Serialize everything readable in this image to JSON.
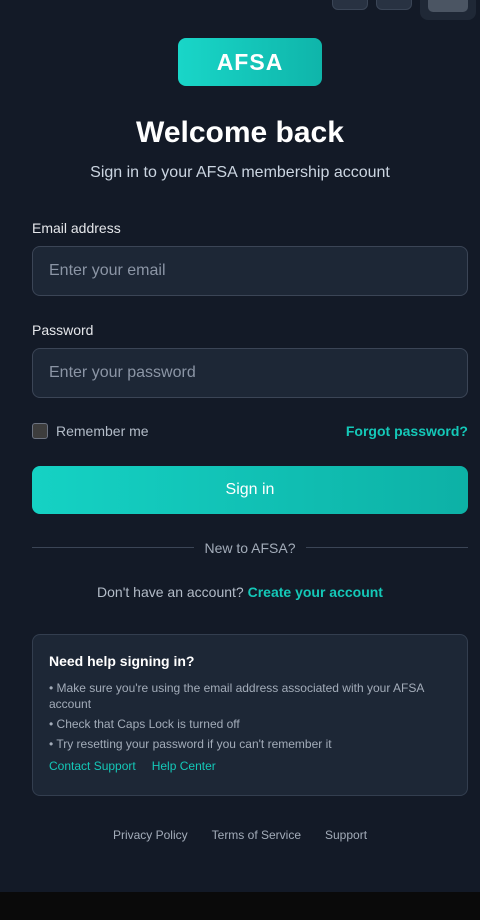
{
  "brand": {
    "logo_text": "AFSA",
    "accent": "#14c8b8"
  },
  "header": {
    "title": "Welcome back",
    "subtitle": "Sign in to your AFSA membership account"
  },
  "form": {
    "email_label": "Email address",
    "email_placeholder": "Enter your email",
    "email_value": "",
    "password_label": "Password",
    "password_placeholder": "Enter your password",
    "password_value": "",
    "remember_label": "Remember me",
    "remember_checked": false,
    "forgot_label": "Forgot password?",
    "submit_label": "Sign in"
  },
  "divider": {
    "text": "New to AFSA?"
  },
  "signup": {
    "prompt": "Don't have an account?",
    "link_label": "Create your account"
  },
  "help": {
    "title": "Need help signing in?",
    "items": [
      "• Make sure you're using the email address associated with your AFSA account",
      "• Check that Caps Lock is turned off",
      "• Try resetting your password if you can't remember it"
    ],
    "links": [
      "Contact Support",
      "Help Center"
    ]
  },
  "footer": {
    "links": [
      "Privacy Policy",
      "Terms of Service",
      "Support"
    ]
  }
}
